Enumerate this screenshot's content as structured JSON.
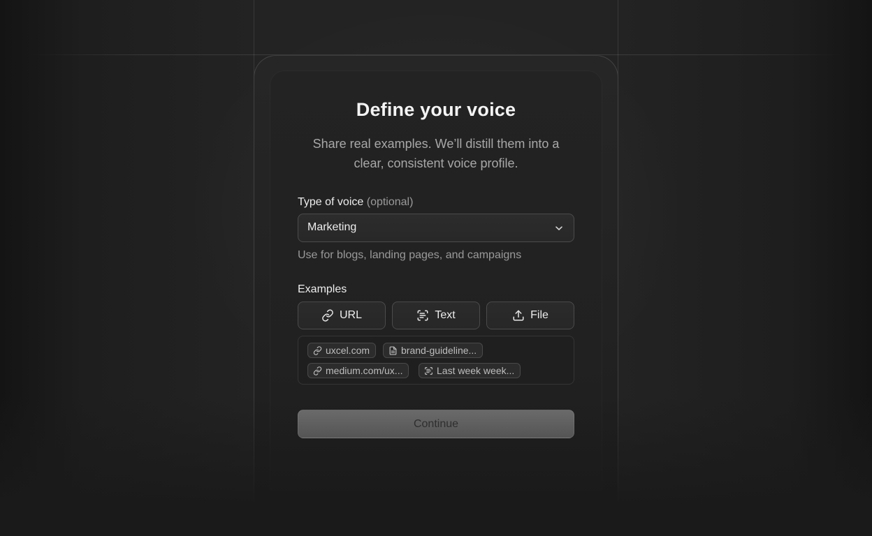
{
  "header": {
    "title": "Define your voice",
    "subtitle": "Share real examples. We’ll distill them into a clear, consistent voice profile."
  },
  "voice_type": {
    "label": "Type of voice",
    "optional_label": "(optional)",
    "selected": "Marketing",
    "helper": "Use for blogs, landing pages, and campaigns"
  },
  "examples": {
    "label": "Examples",
    "buttons": [
      {
        "label": "URL",
        "icon": "link-icon"
      },
      {
        "label": "Text",
        "icon": "text-scan-icon"
      },
      {
        "label": "File",
        "icon": "upload-icon"
      }
    ],
    "items": [
      {
        "label": "uxcel.com",
        "icon": "link-icon"
      },
      {
        "label": "brand-guideline...",
        "icon": "document-icon"
      },
      {
        "label": "medium.com/ux...",
        "icon": "link-icon"
      },
      {
        "label": "Last week week...",
        "icon": "text-scan-icon"
      }
    ]
  },
  "footer": {
    "continue_label": "Continue"
  }
}
